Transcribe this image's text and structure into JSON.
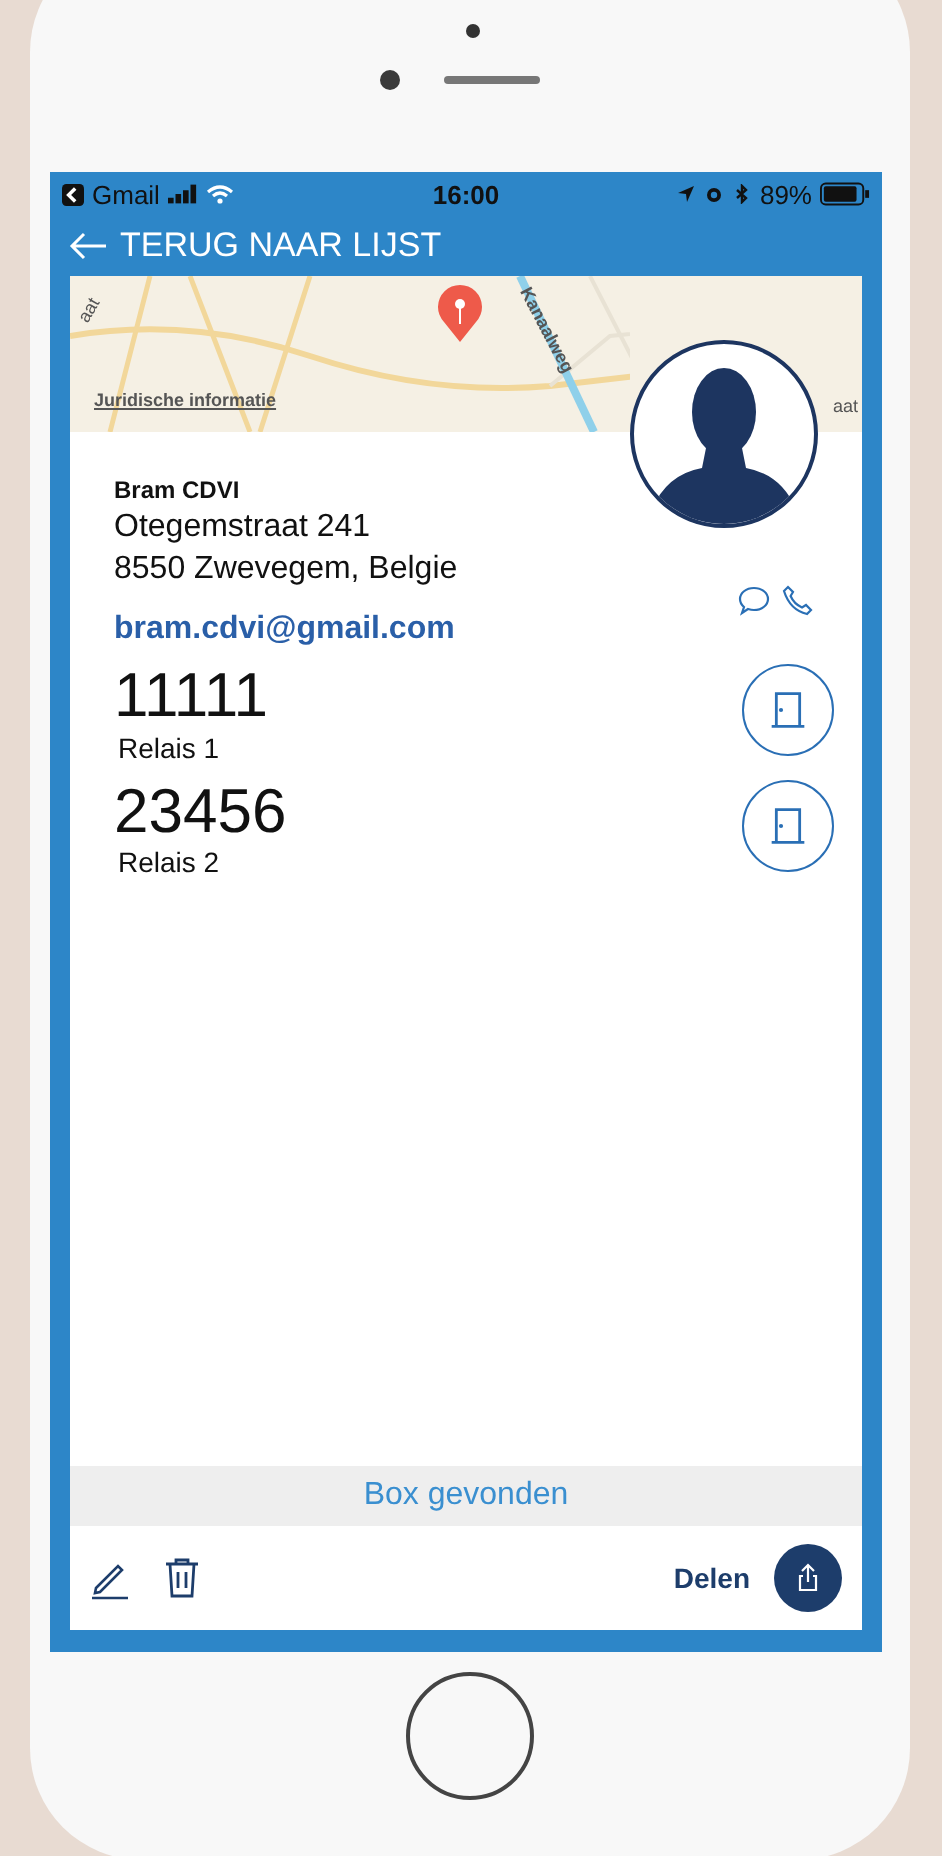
{
  "status_bar": {
    "back_app": "Gmail",
    "time": "16:00",
    "battery": "89%"
  },
  "nav": {
    "back_label": "TERUG NAAR LIJST"
  },
  "map": {
    "street_labels": [
      "aat",
      "Kanaalweg",
      "aat"
    ],
    "legal_link": "Juridische informatie"
  },
  "contact": {
    "name": "Bram CDVI",
    "address_lines": [
      "Otegemstraat 241",
      "8550 Zwevegem, Belgie"
    ],
    "email": "bram.cdvi@gmail.com"
  },
  "relays": [
    {
      "code": "11111",
      "label": "Relais 1"
    },
    {
      "code": "23456",
      "label": "Relais 2"
    }
  ],
  "status_message": "Box gevonden",
  "toolbar": {
    "share_label": "Delen"
  }
}
